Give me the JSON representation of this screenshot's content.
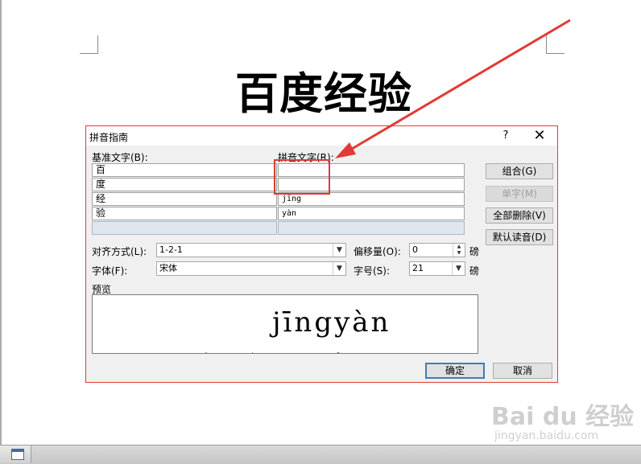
{
  "document": {
    "title": "百度经验"
  },
  "watermark": {
    "brand": "Bai du 经验",
    "url": "jingyan.baidu.com"
  },
  "dialog": {
    "title": "拼音指南",
    "help_label": "?",
    "close_label": "✕",
    "base_text_label": "基准文字(B):",
    "ruby_text_label": "拼音文字(R):",
    "rows": [
      {
        "base": "百",
        "ruby": ""
      },
      {
        "base": "度",
        "ruby": ""
      },
      {
        "base": "经",
        "ruby": "jīng"
      },
      {
        "base": "验",
        "ruby": "yàn"
      },
      {
        "base": "",
        "ruby": ""
      }
    ],
    "buttons": {
      "group": "组合(G)",
      "mono": "单字(M)",
      "clear_all": "全部删除(V)",
      "default_reading": "默认读音(D)",
      "ok": "确定",
      "cancel": "取消"
    },
    "alignment_label": "对齐方式(L):",
    "alignment_value": "1-2-1",
    "offset_label": "偏移量(O):",
    "offset_value": "0",
    "offset_unit": "磅",
    "font_label": "字体(F):",
    "font_value": "宋体",
    "size_label": "字号(S):",
    "size_value": "21",
    "size_unit": "磅",
    "preview_label": "预览",
    "preview_ruby": "jīngyàn",
    "preview_base": "百度经验"
  },
  "annotation_color": "#e23a35"
}
